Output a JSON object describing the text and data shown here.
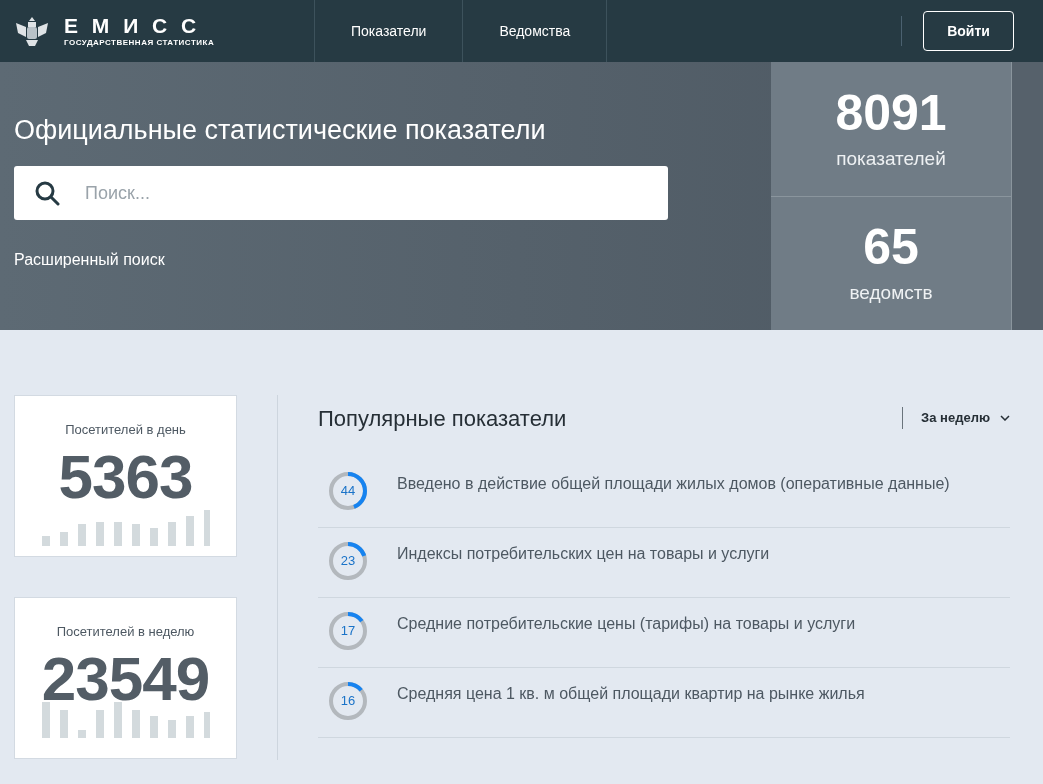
{
  "header": {
    "logo_title": "Е М И С С",
    "logo_subtitle": "ГОСУДАРСТВЕННАЯ СТАТИСТИКА",
    "nav": [
      {
        "label": "Показатели"
      },
      {
        "label": "Ведомства"
      }
    ],
    "login": "Войти"
  },
  "hero": {
    "title": "Официальные статистические показатели",
    "search": {
      "placeholder": "Поиск..."
    },
    "advanced_link": "Расширенный поиск",
    "stats": [
      {
        "value": "8091",
        "label": "показателей"
      },
      {
        "value": "65",
        "label": "ведомств"
      }
    ]
  },
  "visitors": [
    {
      "label": "Посетителей в день",
      "value": "5363"
    },
    {
      "label": "Посетителей в неделю",
      "value": "23549"
    }
  ],
  "popular": {
    "title": "Популярные показатели",
    "period": "За неделю",
    "items": [
      {
        "count": "44",
        "level": 0.44,
        "name": "Введено в действие общей площади жилых домов (оперативные данные)"
      },
      {
        "count": "23",
        "level": 0.2,
        "name": "Индексы потребительских цен на товары и услуги"
      },
      {
        "count": "17",
        "level": 0.15,
        "name": "Средние потребительские цены (тарифы) на товары и услуги"
      },
      {
        "count": "16",
        "level": 0.14,
        "name": "Средняя цена 1 кв. м общей площади квартир на рынке жилья"
      }
    ]
  }
}
